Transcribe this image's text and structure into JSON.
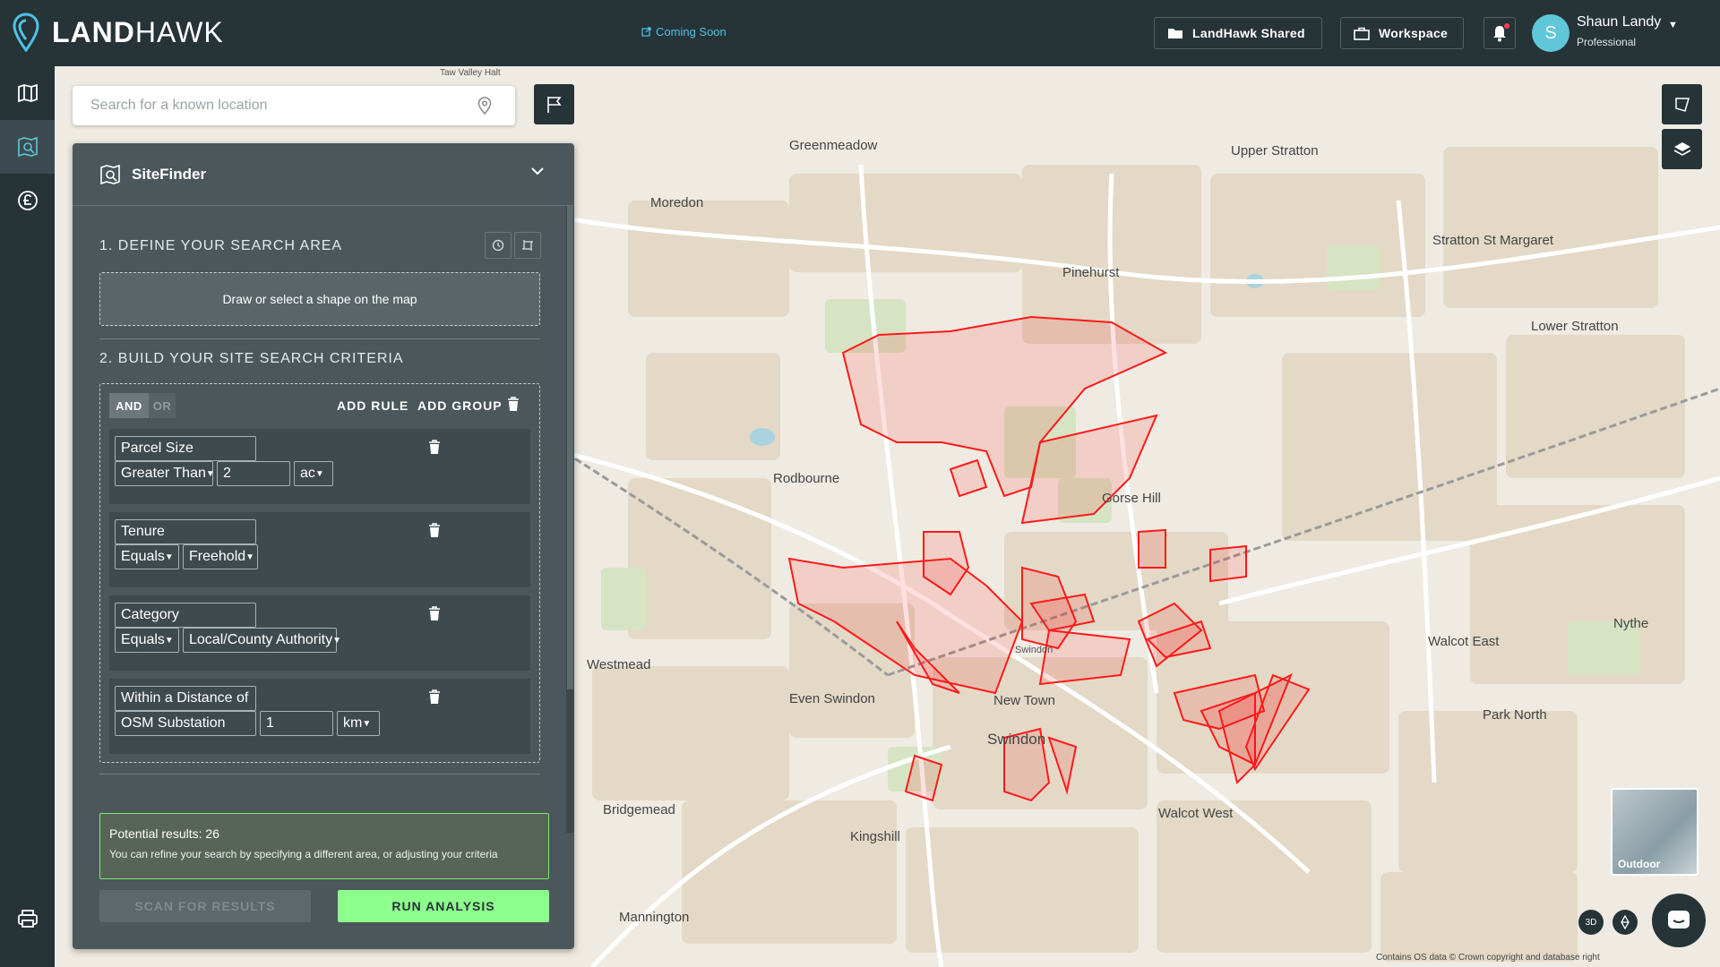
{
  "header": {
    "logo_bold": "LAND",
    "logo_light": "HAWK",
    "coming_soon": "Coming Soon",
    "shared_label": "LandHawk Shared",
    "workspace_label": "Workspace",
    "user_initial": "S",
    "user_name": "Shaun Landy",
    "user_role": "Professional"
  },
  "search": {
    "placeholder": "Search for a known location"
  },
  "panel": {
    "title": "SiteFinder",
    "section1": "1. DEFINE YOUR SEARCH AREA",
    "draw_prompt": "Draw or select a shape on the map",
    "section2": "2. BUILD YOUR SITE SEARCH CRITERIA",
    "and_label": "AND",
    "or_label": "OR",
    "add_rule": "ADD RULE",
    "add_group": "ADD GROUP",
    "rules": [
      {
        "field": "Parcel Size",
        "operator": "Greater Than",
        "value": "2",
        "unit": "ac"
      },
      {
        "field": "Tenure",
        "operator": "Equals",
        "value": "Freehold"
      },
      {
        "field": "Category",
        "operator": "Equals",
        "value": "Local/County Authority"
      },
      {
        "field": "Within a Distance of",
        "operator": "OSM Substation",
        "value": "1",
        "unit": "km"
      }
    ],
    "results_title": "Potential results: 26",
    "results_sub": "You can refine your search by specifying a different area, or adjusting your criteria",
    "scan_label": "SCAN FOR RESULTS",
    "run_label": "RUN ANALYSIS"
  },
  "map": {
    "places": [
      "Greenmeadow",
      "Moredon",
      "Pinehurst",
      "Upper Stratton",
      "Stratton St Margaret",
      "Lower Stratton",
      "Rodbourne",
      "Gorse Hill",
      "Westmead",
      "Even Swindon",
      "Swindon",
      "New Town",
      "Walcot East",
      "Walcot West",
      "Park North",
      "Nythe",
      "Bridgemead",
      "Kingshill",
      "Mannington"
    ],
    "station_top": "Taw Valley Halt",
    "station_swindon": "Swindon",
    "basemap_label": "Outdoor",
    "btn_3d": "3D",
    "attribution": "Contains OS data © Crown copyright and database right"
  },
  "colors": {
    "accent_green": "#8dff8d",
    "highlight_red": "#ff1a1a",
    "panel": "#4b575b",
    "topbar": "#263337"
  }
}
